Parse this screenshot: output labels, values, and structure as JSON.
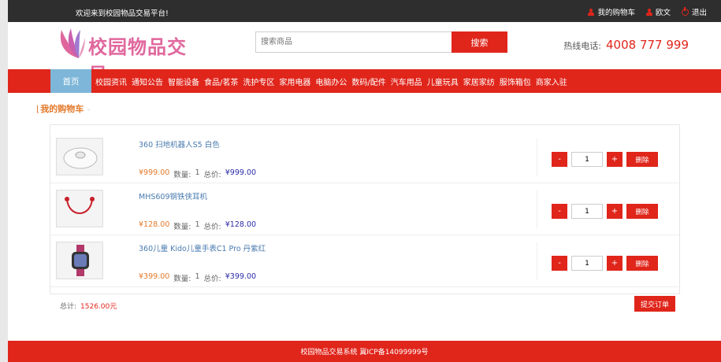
{
  "topbar": {
    "welcome": "欢迎来到校园物品交易平台!",
    "links": [
      "我的购物车",
      "欧文",
      "退出"
    ]
  },
  "header": {
    "logo_text": "校园物品交易",
    "search_placeholder": "搜索商品",
    "search_button": "搜索",
    "hotline_label": "热线电话:",
    "hotline_number": "4008 777 999"
  },
  "nav": {
    "home": "首页",
    "items": [
      "校园资讯",
      "通知公告",
      "智能设备",
      "食品/茗茶",
      "洗护专区",
      "家用电器",
      "电脑办公",
      "数码/配件",
      "汽车用品",
      "儿童玩具",
      "家居家纺",
      "服饰箱包",
      "商家入驻"
    ]
  },
  "section": {
    "title": "我的购物车"
  },
  "cart": {
    "qty_label": "数量:",
    "total_label": "总价:",
    "minus": "-",
    "plus": "+",
    "delete": "删除",
    "items": [
      {
        "name": "360 扫地机器人S5 白色",
        "price": "¥999.00",
        "qty": "1",
        "total": "¥999.00",
        "qty_value": "1",
        "icon": "robot-vacuum-icon"
      },
      {
        "name": "MHS609钢铁侠耳机",
        "price": "¥128.00",
        "qty": "1",
        "total": "¥128.00",
        "qty_value": "1",
        "icon": "earphones-icon"
      },
      {
        "name": "360儿童 Kido儿童手表C1 Pro 丹紫红",
        "price": "¥399.00",
        "qty": "1",
        "total": "¥399.00",
        "qty_value": "1",
        "icon": "kids-watch-icon"
      }
    ]
  },
  "summary": {
    "label": "总计:",
    "value": "1526.00元",
    "submit": "提交订单"
  },
  "footer": {
    "text": "校园物品交易系统 冀ICP备14099999号"
  },
  "colors": {
    "accent": "#e0251b",
    "home_tab": "#7db6d8",
    "logo": "#e0679d",
    "topbar": "#2e2e2e"
  }
}
